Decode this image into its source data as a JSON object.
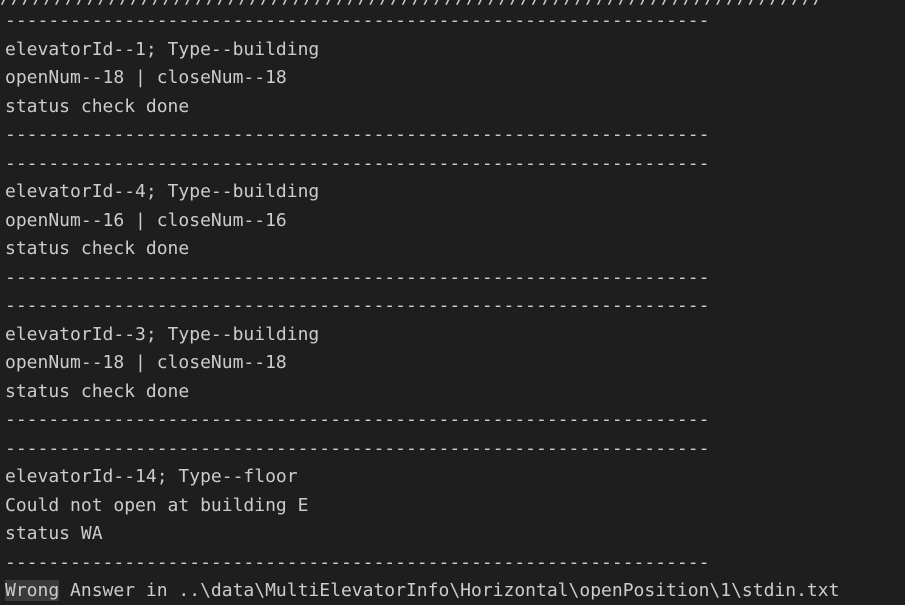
{
  "terminal": {
    "top_partial": "////////////////////////////////////////////////////////////////////////////",
    "separator": "-----------------------------------------------------------------",
    "blocks": [
      {
        "id_line": "elevatorId--1; Type--building",
        "count_line": "openNum--18 | closeNum--18",
        "status_line": "status check done"
      },
      {
        "id_line": "elevatorId--4; Type--building",
        "count_line": "openNum--16 | closeNum--16",
        "status_line": "status check done"
      },
      {
        "id_line": "elevatorId--3; Type--building",
        "count_line": "openNum--18 | closeNum--18",
        "status_line": "status check done"
      },
      {
        "id_line": "elevatorId--14; Type--floor",
        "count_line": "Could not open at building E",
        "status_line": "status WA"
      }
    ],
    "final_highlight": "Wrong",
    "final_rest": " Answer in ..\\data\\MultiElevatorInfo\\Horizontal\\openPosition\\1\\stdin.txt"
  }
}
